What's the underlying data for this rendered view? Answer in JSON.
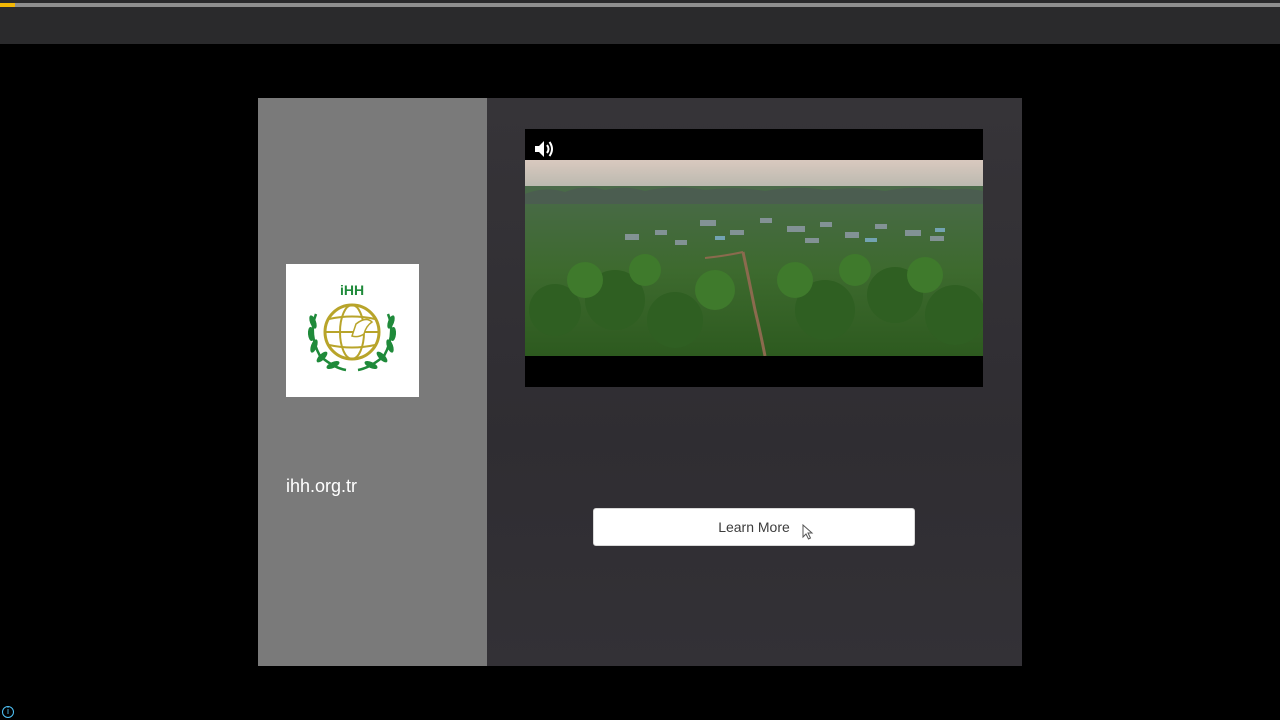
{
  "progress": {
    "fraction": 0.012,
    "fill_color": "#f2b705",
    "track_color": "#8f8f8f"
  },
  "advertiser": {
    "logo_text": "iHH",
    "domain": "ihh.org.tr"
  },
  "video": {
    "volume_icon": "volume-icon"
  },
  "cta": {
    "label": "Learn More"
  },
  "corner": {
    "info_glyph": "i"
  },
  "colors": {
    "left_panel": "#7a7a7a",
    "right_panel": "#333136",
    "logo_green": "#1f8a3a",
    "logo_gold": "#b8a42a"
  }
}
